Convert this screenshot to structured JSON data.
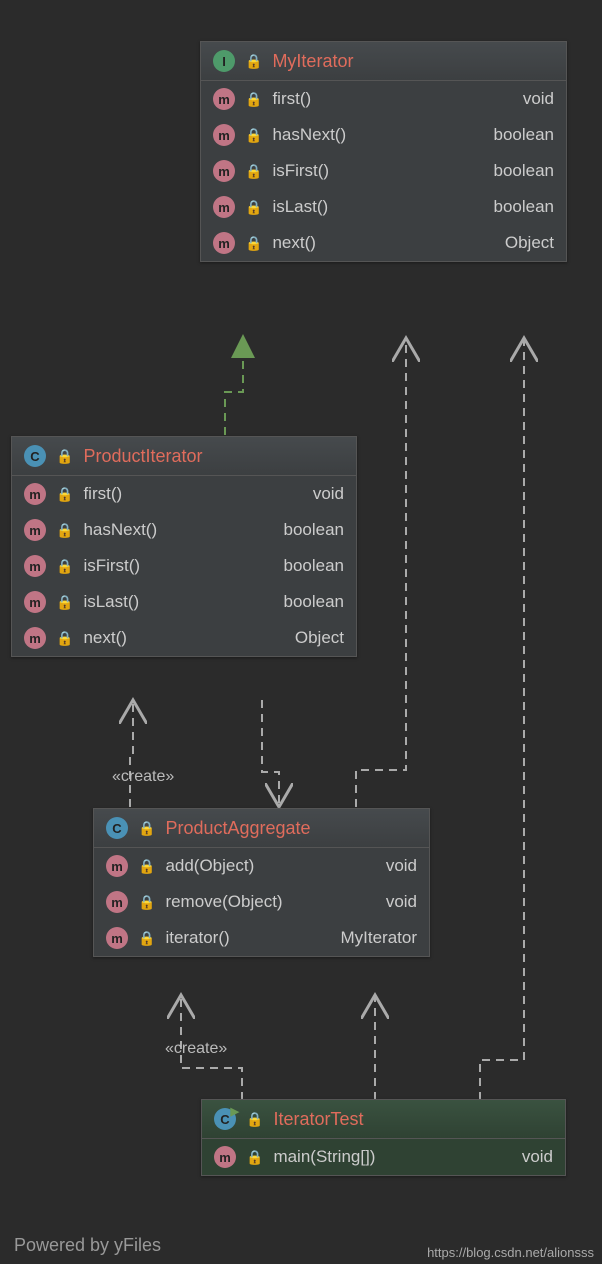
{
  "classes": {
    "myIterator": {
      "title": "MyIterator",
      "type": "I",
      "members": [
        {
          "name": "first()",
          "ret": "void"
        },
        {
          "name": "hasNext()",
          "ret": "boolean"
        },
        {
          "name": "isFirst()",
          "ret": "boolean"
        },
        {
          "name": "isLast()",
          "ret": "boolean"
        },
        {
          "name": "next()",
          "ret": "Object"
        }
      ]
    },
    "productIterator": {
      "title": "ProductIterator",
      "type": "C",
      "members": [
        {
          "name": "first()",
          "ret": "void"
        },
        {
          "name": "hasNext()",
          "ret": "boolean"
        },
        {
          "name": "isFirst()",
          "ret": "boolean"
        },
        {
          "name": "isLast()",
          "ret": "boolean"
        },
        {
          "name": "next()",
          "ret": "Object"
        }
      ]
    },
    "productAggregate": {
      "title": "ProductAggregate",
      "type": "C",
      "members": [
        {
          "name": "add(Object)",
          "ret": "void"
        },
        {
          "name": "remove(Object)",
          "ret": "void"
        },
        {
          "name": "iterator()",
          "ret": "MyIterator"
        }
      ]
    },
    "iteratorTest": {
      "title": "IteratorTest",
      "type": "C",
      "members": [
        {
          "name": "main(String[])",
          "ret": "void"
        }
      ]
    }
  },
  "labels": {
    "create": "«create»"
  },
  "footer": {
    "left": "Powered by yFiles",
    "right": "https://blog.csdn.net/alionsss"
  }
}
